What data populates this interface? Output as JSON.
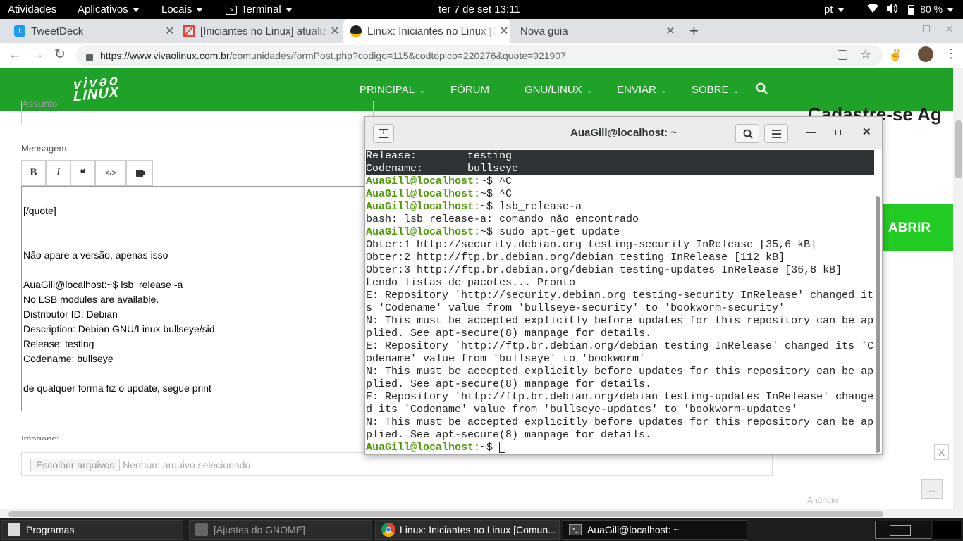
{
  "topbar": {
    "activities": "Atividades",
    "applications": "Aplicativos",
    "places": "Locais",
    "terminal_app": "Terminal",
    "clock": "ter 7 de set  13:11",
    "keyboard_layout": "pt",
    "battery": "80 %"
  },
  "tabs": [
    {
      "title": "TweetDeck",
      "icon": "twitter-icon"
    },
    {
      "title": "[Iniciantes no Linux] atualizar",
      "icon": "gmail-icon"
    },
    {
      "title": "Linux: Iniciantes no Linux [Comunidade]",
      "icon": "tux-icon"
    },
    {
      "title": "Nova guia",
      "icon": ""
    }
  ],
  "url": {
    "host": "https://www.vivaolinux.com.br",
    "path": "/comunidades/formPost.php?codigo=115&codtopico=220276&quote=921907"
  },
  "site": {
    "logo_line1": "vivəo",
    "logo_line2": "LINUX",
    "nav": [
      "PRINCIPAL",
      "FÓRUM",
      "GNU/LINUX",
      "ENVIAR",
      "SOBRE"
    ],
    "subject_placeholder": "Assunto",
    "message_label": "Mensagem",
    "toolbar": {
      "bold": "B",
      "italic": "I",
      "quote": "❝",
      "code": "</>"
    },
    "editor_lines": [
      "[/quote]",
      "Não apare a versão, apenas isso",
      "AuaGill@localhost:~$ lsb_release -a",
      "No LSB modules are available.",
      "Distributor ID:  Debian",
      "Description:     Debian GNU/Linux bullseye/sid",
      "Release:  testing",
      "Codename:      bullseye",
      "de qualquer forma fiz o update, segue print"
    ],
    "images_label": "Imagens:",
    "choose_files": "Escolher arquivos",
    "no_file": "Nenhum arquivo selecionado",
    "sidebar_heading": "Cadastre-se Ag",
    "open_button": "ABRIR",
    "ad_label": "Anúncio",
    "close_ad": "X"
  },
  "terminal": {
    "title": "AuaGill@localhost: ~",
    "prompt": "AuaGill@localhost",
    "lines": [
      {
        "text": "Release:        testing",
        "sel": true
      },
      {
        "text": "Codename:       bullseye",
        "sel": true
      },
      {
        "prompt": true,
        "cmd": "^C"
      },
      {
        "prompt": true,
        "cmd": "^C"
      },
      {
        "prompt": true,
        "cmd": "lsb_release-a"
      },
      {
        "text": "bash: lsb_release-a: comando não encontrado"
      },
      {
        "prompt": true,
        "cmd": "sudo apt-get update"
      },
      {
        "text": "Obter:1 http://security.debian.org testing-security InRelease [35,6 kB]"
      },
      {
        "text": "Obter:2 http://ftp.br.debian.org/debian testing InRelease [112 kB]"
      },
      {
        "text": "Obter:3 http://ftp.br.debian.org/debian testing-updates InRelease [36,8 kB]"
      },
      {
        "text": "Lendo listas de pacotes... Pronto"
      },
      {
        "text": "E: Repository 'http://security.debian.org testing-security InRelease' changed it"
      },
      {
        "text": "s 'Codename' value from 'bullseye-security' to 'bookworm-security'"
      },
      {
        "text": "N: This must be accepted explicitly before updates for this repository can be ap"
      },
      {
        "text": "plied. See apt-secure(8) manpage for details."
      },
      {
        "text": "E: Repository 'http://ftp.br.debian.org/debian testing InRelease' changed its 'C"
      },
      {
        "text": "odename' value from 'bullseye' to 'bookworm'"
      },
      {
        "text": "N: This must be accepted explicitly before updates for this repository can be ap"
      },
      {
        "text": "plied. See apt-secure(8) manpage for details."
      },
      {
        "text": "E: Repository 'http://ftp.br.debian.org/debian testing-updates InRelease' change"
      },
      {
        "text": "d its 'Codename' value from 'bullseye-updates' to 'bookworm-updates'"
      },
      {
        "text": "N: This must be accepted explicitly before updates for this repository can be ap"
      },
      {
        "text": "plied. See apt-secure(8) manpage for details."
      },
      {
        "prompt": true,
        "cmd": "",
        "cursor": true
      }
    ]
  },
  "taskbar": {
    "items": [
      "Programas",
      "[Ajustes do GNOME]",
      "Linux: Iniciantes no Linux [Comun...",
      "AuaGill@localhost: ~"
    ]
  },
  "colors": {
    "site_green": "#1fa228",
    "prompt_green": "#4e9a06",
    "open_btn": "#22cc22"
  }
}
